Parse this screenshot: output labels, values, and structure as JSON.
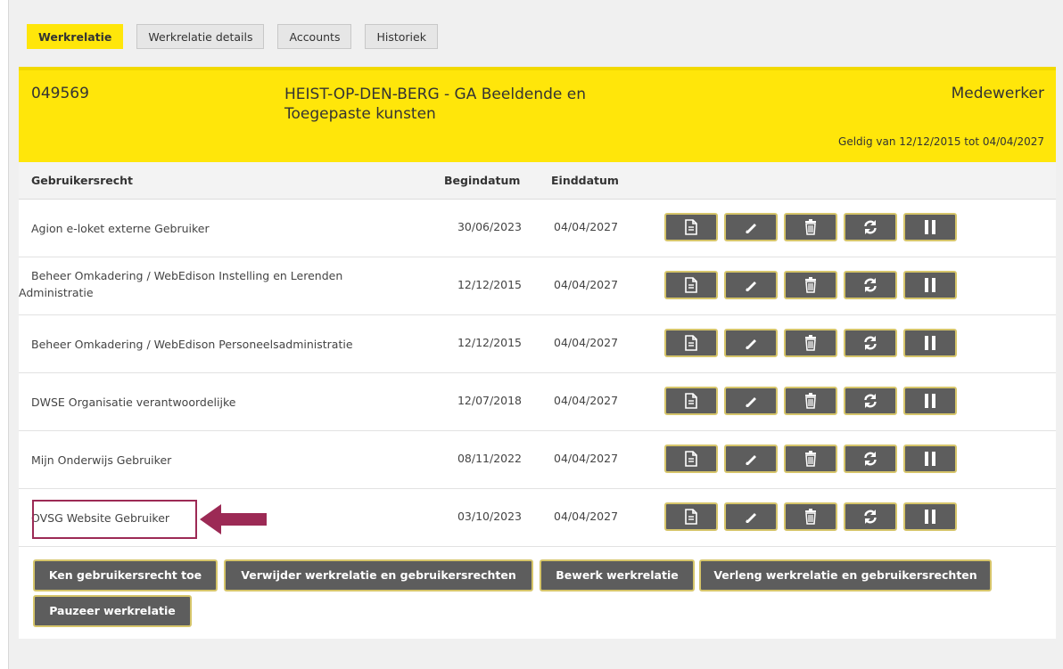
{
  "tabs": [
    "Werkrelatie",
    "Werkrelatie details",
    "Accounts",
    "Historiek"
  ],
  "header": {
    "code": "049569",
    "institution": "HEIST-OP-DEN-BERG - GA Beeldende en Toegepaste kunsten",
    "role": "Medewerker",
    "validity": "Geldig van 12/12/2015 tot 04/04/2027"
  },
  "table": {
    "columns": [
      "Gebruikersrecht",
      "Begindatum",
      "Einddatum"
    ],
    "rows": [
      {
        "name": "Agion e-loket externe Gebruiker",
        "begin": "30/06/2023",
        "end": "04/04/2027"
      },
      {
        "name": "Beheer Omkadering / WebEdison Instelling en Lerenden Administratie",
        "begin": "12/12/2015",
        "end": "04/04/2027"
      },
      {
        "name": "Beheer Omkadering / WebEdison Personeelsadministratie",
        "begin": "12/12/2015",
        "end": "04/04/2027"
      },
      {
        "name": "DWSE Organisatie verantwoordelijke",
        "begin": "12/07/2018",
        "end": "04/04/2027"
      },
      {
        "name": "Mijn Onderwijs Gebruiker",
        "begin": "08/11/2022",
        "end": "04/04/2027"
      },
      {
        "name": "OVSG Website Gebruiker",
        "begin": "03/10/2023",
        "end": "04/04/2027"
      }
    ],
    "row_actions": [
      "document-icon",
      "pencil-icon",
      "trash-icon",
      "refresh-icon",
      "pause-icon"
    ]
  },
  "actions": {
    "assign": "Ken gebruikersrecht toe",
    "delete": "Verwijder werkrelatie en gebruikersrechten",
    "edit": "Bewerk werkrelatie",
    "extend": "Verleng werkrelatie en gebruikersrechten",
    "pause": "Pauzeer werkrelatie"
  },
  "colors": {
    "accent_yellow": "#ffe60a",
    "button_dark": "#5d5d5d",
    "highlight": "#9c2a55"
  }
}
